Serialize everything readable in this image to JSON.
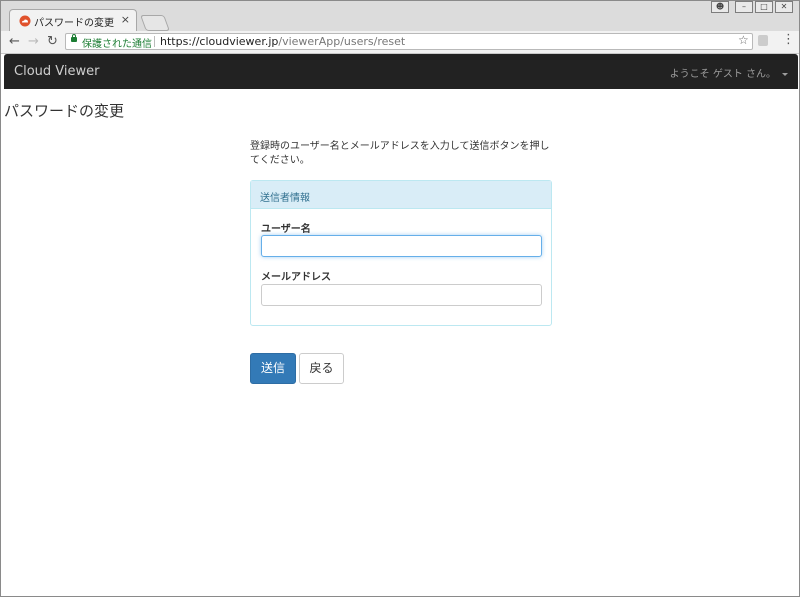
{
  "browser": {
    "tab_title": "パスワードの変更",
    "tab_close": "×",
    "security_label": "保護された通信",
    "url_origin": "https://cloudviewer.jp",
    "url_path": "/viewerApp/users/reset"
  },
  "navbar": {
    "brand": "Cloud Viewer",
    "welcome": "ようこそ ゲスト さん。"
  },
  "page": {
    "title": "パスワードの変更",
    "intro": "登録時のユーザー名とメールアドレスを入力して送信ボタンを押してください。"
  },
  "panel": {
    "heading": "送信者情報",
    "fields": [
      {
        "label": "ユーザー名",
        "value": "",
        "focused": true
      },
      {
        "label": "メールアドレス",
        "value": "",
        "focused": false
      }
    ]
  },
  "buttons": {
    "submit": "送信",
    "back": "戻る"
  },
  "colors": {
    "navbar_bg": "#222222",
    "primary": "#337ab7",
    "panel_heading_bg": "#d9edf7",
    "panel_heading_text": "#31708f",
    "secure_green": "#1c7d33"
  }
}
